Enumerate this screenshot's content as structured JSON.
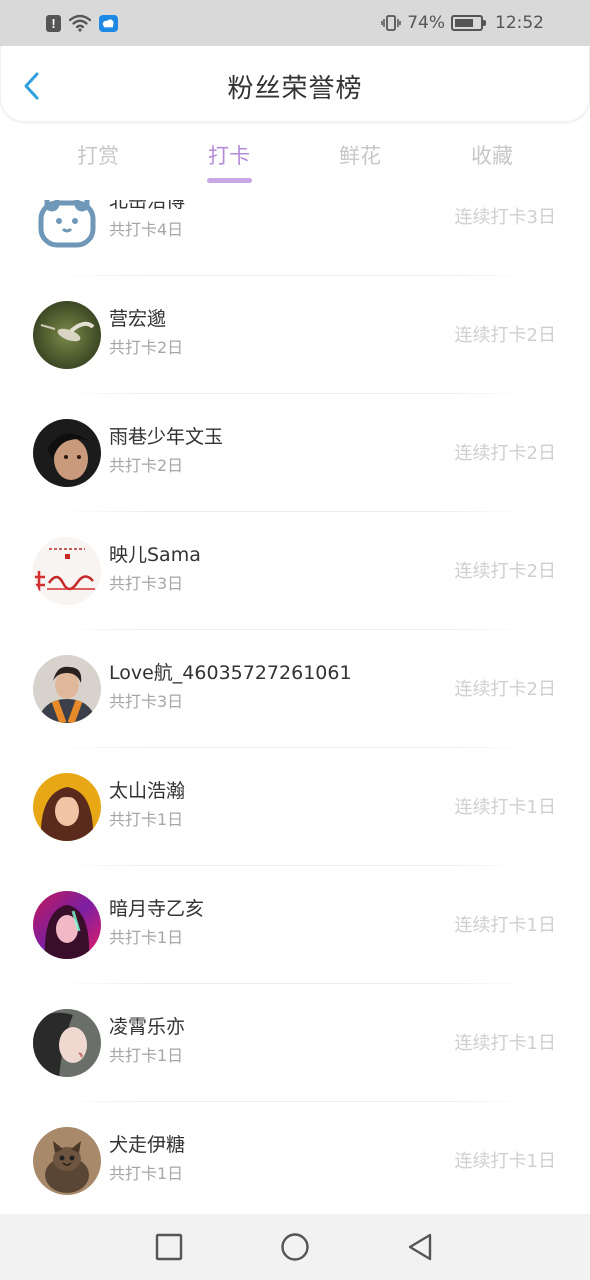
{
  "status_bar": {
    "battery": "74%",
    "time": "12:52",
    "icons": [
      "alert-icon",
      "wifi-icon",
      "weather-icon",
      "vibrate-icon",
      "battery-icon"
    ]
  },
  "header": {
    "title": "粉丝荣誉榜",
    "back_icon": "chevron-left-icon"
  },
  "tabs": [
    {
      "label": "打赏",
      "active": false
    },
    {
      "label": "打卡",
      "active": true
    },
    {
      "label": "鲜花",
      "active": false
    },
    {
      "label": "收藏",
      "active": false
    }
  ],
  "colors": {
    "accent": "#c9a6e6",
    "back_arrow": "#2f9ee0"
  },
  "fans": [
    {
      "name": "北岳浩博",
      "total": "共打卡4日",
      "streak": "连续打卡3日",
      "avatar": "bunny-avatar"
    },
    {
      "name": "营宏邈",
      "total": "共打卡2日",
      "streak": "连续打卡2日",
      "avatar": "hummingbird-avatar"
    },
    {
      "name": "雨巷少年文玉",
      "total": "共打卡2日",
      "streak": "连续打卡2日",
      "avatar": "boy-portrait-avatar"
    },
    {
      "name": "映儿Sama",
      "total": "共打卡3日",
      "streak": "连续打卡2日",
      "avatar": "calligraphy-avatar"
    },
    {
      "name": "Love航_46035727261061",
      "total": "共打卡3日",
      "streak": "连续打卡2日",
      "avatar": "person-orange-scarf-avatar"
    },
    {
      "name": "太山浩瀚",
      "total": "共打卡1日",
      "streak": "连续打卡1日",
      "avatar": "girl-yellow-avatar"
    },
    {
      "name": "暗月寺乙亥",
      "total": "共打卡1日",
      "streak": "连续打卡1日",
      "avatar": "girl-pink-avatar"
    },
    {
      "name": "凌霄乐亦",
      "total": "共打卡1日",
      "streak": "连续打卡1日",
      "avatar": "girl-profile-avatar"
    },
    {
      "name": "犬走伊糖",
      "total": "共打卡1日",
      "streak": "连续打卡1日",
      "avatar": "cat-avatar"
    }
  ],
  "nav_bar": {
    "icons": [
      "recent-apps-icon",
      "home-icon",
      "back-icon"
    ]
  }
}
